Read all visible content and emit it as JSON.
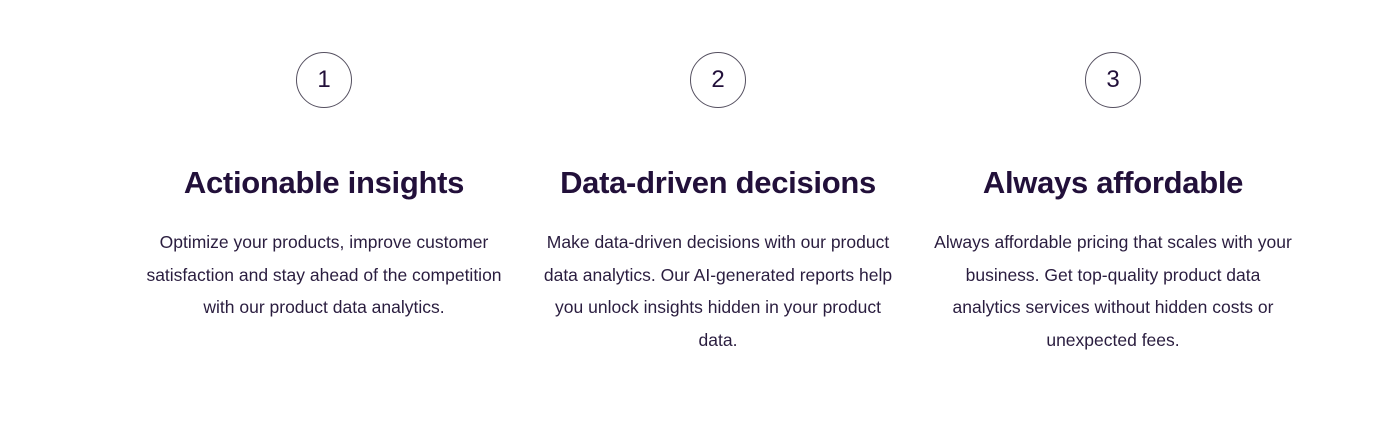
{
  "features": [
    {
      "number": "1",
      "title": "Actionable insights",
      "description": "Optimize your products, improve customer satisfaction and stay ahead of the competition with our product data analytics."
    },
    {
      "number": "2",
      "title": "Data-driven decisions",
      "description": "Make data-driven decisions with our product data analytics. Our AI-generated reports help you unlock insights hidden in your product data."
    },
    {
      "number": "3",
      "title": "Always affordable",
      "description": "Always affordable pricing that scales with your business. Get top-quality product data analytics services without hidden costs or unexpected fees."
    }
  ],
  "colors": {
    "text": "#22103a",
    "circle_border": "#555060",
    "background": "#ffffff"
  }
}
